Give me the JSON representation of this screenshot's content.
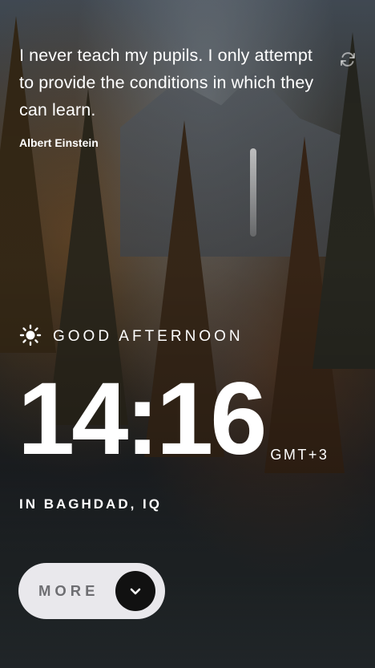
{
  "quote": {
    "text": "I never teach my pupils. I only attempt to provide the conditions in which they can learn.",
    "author": "Albert Einstein"
  },
  "icons": {
    "refresh": "refresh-icon",
    "greeting": "sun-icon",
    "more": "chevron-down-icon"
  },
  "greeting": {
    "text": "GOOD AFTERNOON"
  },
  "clock": {
    "time": "14:16",
    "timezone": "GMT+3"
  },
  "location": {
    "text": "IN BAGHDAD, IQ"
  },
  "more_button": {
    "label": "MORE"
  },
  "colors": {
    "text": "#ffffff",
    "button_bg": "#e9e8ec",
    "button_text": "#6e6e72",
    "button_icon_bg": "#111111"
  }
}
